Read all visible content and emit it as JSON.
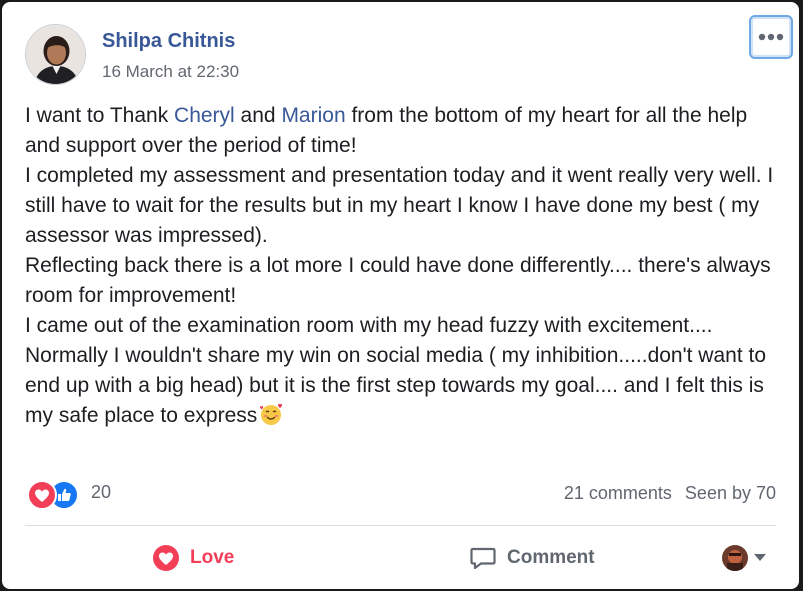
{
  "post": {
    "author": "Shilpa Chitnis",
    "timestamp": "16 March at 22:30",
    "paragraphs": {
      "p1_before": "I want to Thank ",
      "p1_mention1": "Cheryl",
      "p1_and": " and ",
      "p1_mention2": "Marion",
      "p1_after": " from the bottom of my heart for all the help and support over the period of time!",
      "p2": "I completed my assessment and presentation today and it went really very well. I still have to wait for the results but in my heart I know I have done my best ( my assessor was impressed).",
      "p3": "Reflecting back there is a lot more I could have done differently.... there's always room for improvement!",
      "p4": "I came out of the examination room with my head fuzzy with excitement....",
      "p5": "Normally I wouldn't share my win on social media ( my inhibition.....don't want to end up with a big head) but it is the first step towards my goal.... and I felt this is my safe place to express"
    },
    "emoji": "smiling-face-with-hearts-icon"
  },
  "reactions": {
    "icons": [
      "love-reaction-icon",
      "like-reaction-icon"
    ],
    "count": "20"
  },
  "stats": {
    "comments": "21 comments",
    "seen": "Seen by 70"
  },
  "actions": {
    "love": "Love",
    "comment": "Comment"
  },
  "colors": {
    "author": "#385898",
    "love": "#f33e58",
    "like": "#1877f2",
    "muted": "#616770"
  }
}
